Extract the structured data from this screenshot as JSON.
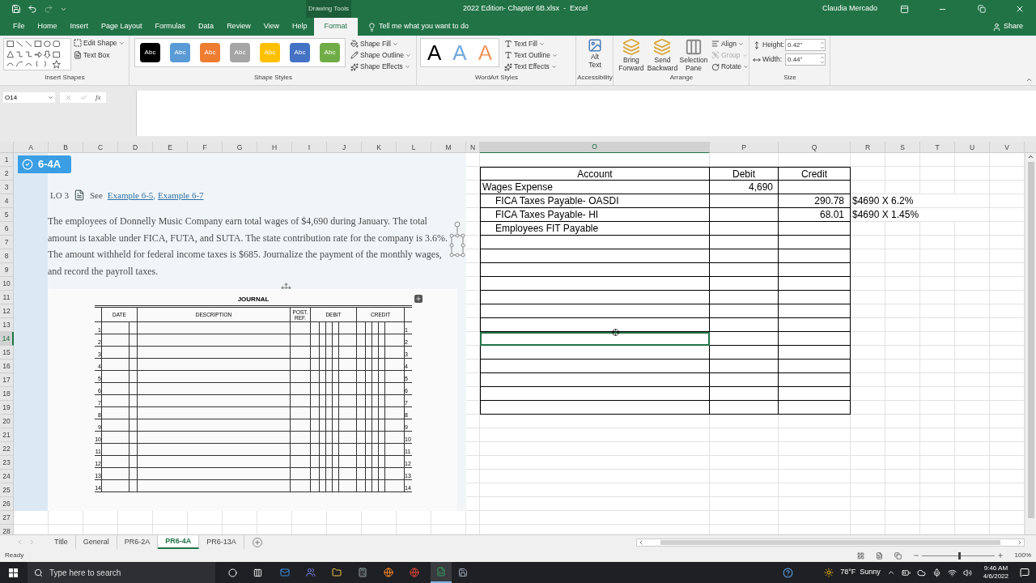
{
  "title_bar": {
    "contextual_label": "Drawing Tools",
    "title": "2022 Edition- Chapter 6B.xlsx  -  Excel",
    "user": "Claudia Mercado"
  },
  "ribbon_tabs": [
    {
      "label": "File",
      "selected": false
    },
    {
      "label": "Home",
      "selected": false
    },
    {
      "label": "Insert",
      "selected": false
    },
    {
      "label": "Page Layout",
      "selected": false
    },
    {
      "label": "Formulas",
      "selected": false
    },
    {
      "label": "Data",
      "selected": false
    },
    {
      "label": "Review",
      "selected": false
    },
    {
      "label": "View",
      "selected": false
    },
    {
      "label": "Help",
      "selected": false
    },
    {
      "label": "Format",
      "selected": true
    }
  ],
  "tell_me": "Tell me what you want to do",
  "share": "Share",
  "insert_shapes": {
    "label": "Insert Shapes",
    "edit_shape": "Edit Shape",
    "text_box": "Text Box"
  },
  "shape_styles": {
    "label": "Shape Styles",
    "swatches": [
      {
        "text": "Abc",
        "color": "#000000"
      },
      {
        "text": "Abc",
        "color": "#5b9bd5"
      },
      {
        "text": "Abc",
        "color": "#ed7d31"
      },
      {
        "text": "Abc",
        "color": "#a5a5a5"
      },
      {
        "text": "Abc",
        "color": "#ffc000"
      },
      {
        "text": "Abc",
        "color": "#4472c4"
      },
      {
        "text": "Abc",
        "color": "#70ad47"
      }
    ],
    "commands": [
      "Shape Fill",
      "Shape Outline",
      "Shape Effects"
    ]
  },
  "wordart_styles": {
    "label": "WordArt Styles",
    "letters": [
      {
        "text": "A",
        "kind": "fill",
        "color": "#000000"
      },
      {
        "text": "A",
        "kind": "fill",
        "color": "#6fa8dc"
      },
      {
        "text": "A",
        "kind": "outline",
        "color": "#ed7d31"
      }
    ],
    "commands": [
      "Text Fill",
      "Text Outline",
      "Text Effects"
    ]
  },
  "accessibility": {
    "label": "Accessibility",
    "alt_text": "Alt Text"
  },
  "arrange": {
    "label": "Arrange",
    "large": [
      "Bring Forward",
      "Send Backward",
      "Selection Pane"
    ],
    "small": [
      {
        "label": "Align",
        "disabled": false
      },
      {
        "label": "Group",
        "disabled": true
      },
      {
        "label": "Rotate",
        "disabled": false
      }
    ]
  },
  "size": {
    "label": "Size",
    "fields": [
      {
        "label": "Height:",
        "value": "0.42\""
      },
      {
        "label": "Width:",
        "value": "0.44\""
      }
    ]
  },
  "formula_bar": {
    "name_box": "O14",
    "function_label": "fx"
  },
  "columns": [
    {
      "label": "A",
      "selected": false
    },
    {
      "label": "B",
      "selected": false
    },
    {
      "label": "C",
      "selected": false
    },
    {
      "label": "D",
      "selected": false
    },
    {
      "label": "E",
      "selected": false
    },
    {
      "label": "F",
      "selected": false
    },
    {
      "label": "G",
      "selected": false
    },
    {
      "label": "H",
      "selected": false
    },
    {
      "label": "I",
      "selected": false
    },
    {
      "label": "J",
      "selected": false
    },
    {
      "label": "K",
      "selected": false
    },
    {
      "label": "L",
      "selected": false
    },
    {
      "label": "M",
      "selected": false
    },
    {
      "label": "N",
      "selected": false
    },
    {
      "label": "O",
      "selected": true
    },
    {
      "label": "P",
      "selected": false
    },
    {
      "label": "Q",
      "selected": false
    },
    {
      "label": "R",
      "selected": false
    },
    {
      "label": "S",
      "selected": false
    },
    {
      "label": "T",
      "selected": false
    },
    {
      "label": "U",
      "selected": false
    },
    {
      "label": "V",
      "selected": false
    }
  ],
  "rows": [
    {
      "label": "1",
      "selected": false
    },
    {
      "label": "2",
      "selected": false
    },
    {
      "label": "3",
      "selected": false
    },
    {
      "label": "4",
      "selected": false
    },
    {
      "label": "5",
      "selected": false
    },
    {
      "label": "6",
      "selected": false
    },
    {
      "label": "7",
      "selected": false
    },
    {
      "label": "8",
      "selected": false
    },
    {
      "label": "9",
      "selected": false
    },
    {
      "label": "10",
      "selected": false
    },
    {
      "label": "11",
      "selected": false
    },
    {
      "label": "12",
      "selected": false
    },
    {
      "label": "13",
      "selected": false
    },
    {
      "label": "14",
      "selected": true
    },
    {
      "label": "15",
      "selected": false
    },
    {
      "label": "16",
      "selected": false
    },
    {
      "label": "17",
      "selected": false
    },
    {
      "label": "18",
      "selected": false
    },
    {
      "label": "19",
      "selected": false
    },
    {
      "label": "20",
      "selected": false
    },
    {
      "label": "21",
      "selected": false
    },
    {
      "label": "22",
      "selected": false
    },
    {
      "label": "23",
      "selected": false
    },
    {
      "label": "24",
      "selected": false
    },
    {
      "label": "25",
      "selected": false
    },
    {
      "label": "26",
      "selected": false
    },
    {
      "label": "27",
      "selected": false
    },
    {
      "label": "28",
      "selected": false
    }
  ],
  "document": {
    "badge": "6-4A",
    "objective": "LO 3",
    "see": "See",
    "links": [
      "Example 6-5",
      "Example 6-7"
    ],
    "link_separator": ",",
    "paragraph": "The employees of Donnelly Music Company earn total wages of $4,690 during January. The total amount is taxable under FICA, FUTA, and SUTA. The state contribution rate for the company is 3.6%. The amount withheld for federal income taxes is $685. Journalize the payment of the monthly wages, and record the payroll taxes.",
    "journal": {
      "title": "JOURNAL",
      "columns": [
        "DATE",
        "DESCRIPTION",
        "POST. REF.",
        "DEBIT",
        "CREDIT"
      ],
      "left_line_numbers": [
        "1",
        "2",
        "3",
        "4",
        "5",
        "6",
        "7",
        "8",
        "9",
        "10",
        "11",
        "12",
        "13",
        "14"
      ],
      "right_line_numbers": [
        "1",
        "2",
        "3",
        "4",
        "5",
        "6",
        "7",
        "8",
        "9",
        "10",
        "11",
        "12",
        "13",
        "14"
      ]
    }
  },
  "table": {
    "headers": [
      "Account",
      "Debit",
      "Credit"
    ],
    "rows": [
      {
        "kind": "debit",
        "account": "Wages Expense",
        "debit": "4,690",
        "selected": false
      },
      {
        "kind": "credit",
        "account": "FICA Taxes Payable- OASDI",
        "credit": "290.78",
        "note": "$4690 X 6.2%",
        "selected": false
      },
      {
        "kind": "credit",
        "account": "FICA Taxes Payable- HI",
        "credit": "68.01",
        "note": "$4690 X 1.45%",
        "selected": false
      },
      {
        "kind": "credit",
        "account": "Employees FIT Payable",
        "selected": false
      },
      {
        "kind": "blank",
        "selected": false
      },
      {
        "kind": "blank",
        "selected": false
      },
      {
        "kind": "blank",
        "selected": false
      },
      {
        "kind": "blank",
        "selected": false
      },
      {
        "kind": "blank",
        "selected": false
      },
      {
        "kind": "blank",
        "selected": false
      },
      {
        "kind": "blank",
        "selected": false
      },
      {
        "kind": "blank",
        "selected": true
      },
      {
        "kind": "blank",
        "selected": false
      },
      {
        "kind": "blank",
        "selected": false
      },
      {
        "kind": "blank",
        "selected": false
      },
      {
        "kind": "blank",
        "selected": false
      },
      {
        "kind": "blank",
        "selected": false
      }
    ]
  },
  "sheet_tabs": [
    {
      "label": "Title",
      "selected": false
    },
    {
      "label": "General",
      "selected": false
    },
    {
      "label": "PR6-2A",
      "selected": false
    },
    {
      "label": "PR6-4A",
      "selected": true
    },
    {
      "label": "PR6-13A",
      "selected": false
    }
  ],
  "status_bar": {
    "status": "Ready",
    "zoom": "100%",
    "zoom_slider": {
      "level": 0.5
    }
  },
  "taskbar": {
    "search_placeholder": "Type here to search",
    "weather": "78°F  Sunny",
    "time": "9:46 AM",
    "date": "4/6/2022"
  }
}
